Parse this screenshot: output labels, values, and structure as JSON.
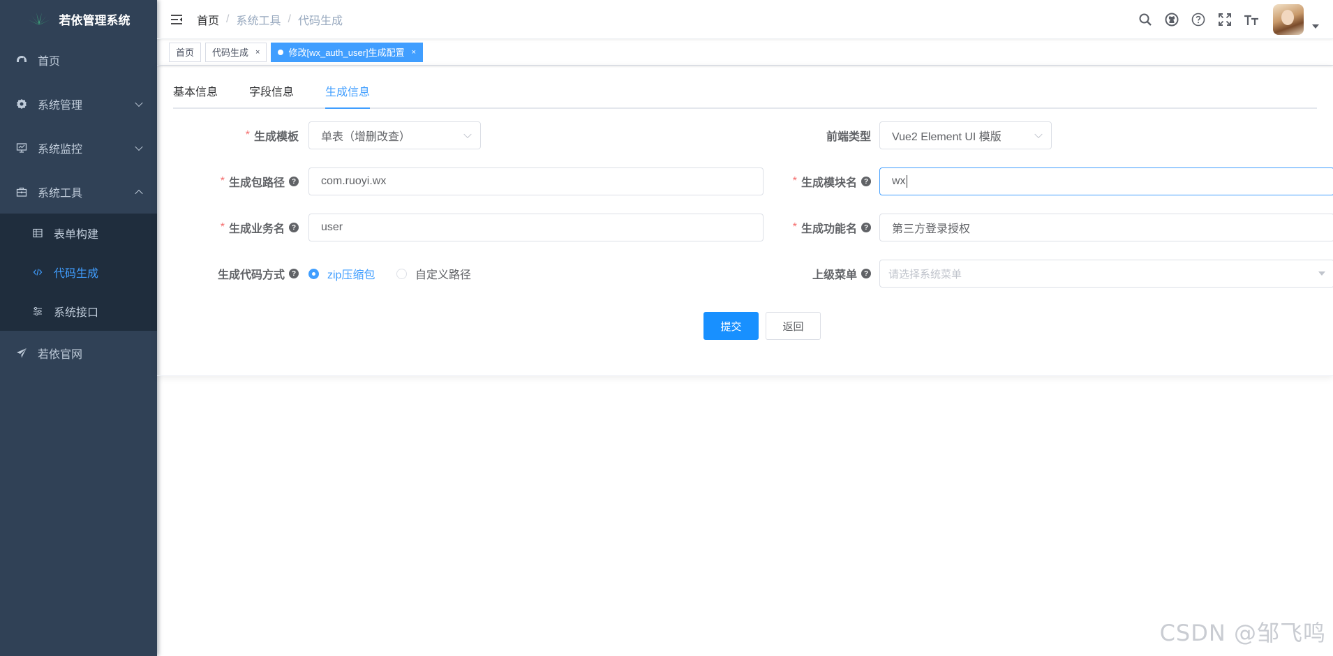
{
  "app": {
    "title": "若依管理系统"
  },
  "sidebar": {
    "items": [
      {
        "label": "首页",
        "icon": "dashboard-icon"
      },
      {
        "label": "系统管理",
        "icon": "gear-icon"
      },
      {
        "label": "系统监控",
        "icon": "monitor-icon"
      },
      {
        "label": "系统工具",
        "icon": "toolbox-icon",
        "expanded": true
      },
      {
        "label": "若依官网",
        "icon": "send-icon"
      }
    ],
    "submenu": [
      {
        "label": "表单构建",
        "icon": "table-icon"
      },
      {
        "label": "代码生成",
        "icon": "code-icon",
        "active": true
      },
      {
        "label": "系统接口",
        "icon": "sliders-icon"
      }
    ]
  },
  "navbar": {
    "breadcrumb": [
      "首页",
      "系统工具",
      "代码生成"
    ],
    "icons": [
      "search-icon",
      "github-icon",
      "question-icon",
      "fullscreen-icon",
      "font-size-icon"
    ]
  },
  "tags": [
    {
      "label": "首页"
    },
    {
      "label": "代码生成"
    },
    {
      "label": "修改[wx_auth_user]生成配置",
      "active": true
    }
  ],
  "tabs": [
    {
      "label": "基本信息"
    },
    {
      "label": "字段信息"
    },
    {
      "label": "生成信息",
      "active": true
    }
  ],
  "form": {
    "template": {
      "label": "生成模板",
      "value": "单表（增删改查）"
    },
    "frontend_type": {
      "label": "前端类型",
      "value": "Vue2 Element UI 模版"
    },
    "package_path": {
      "label": "生成包路径",
      "value": "com.ruoyi.wx"
    },
    "module_name": {
      "label": "生成模块名",
      "value": "wx"
    },
    "business_name": {
      "label": "生成业务名",
      "value": "user"
    },
    "function_name": {
      "label": "生成功能名",
      "value": "第三方登录授权"
    },
    "gen_type": {
      "label": "生成代码方式",
      "options": [
        "zip压缩包",
        "自定义路径"
      ],
      "selected": "zip压缩包"
    },
    "parent_menu": {
      "label": "上级菜单",
      "placeholder": "请选择系统菜单"
    },
    "submit_label": "提交",
    "back_label": "返回",
    "required_mark": "*",
    "help_mark": "?"
  },
  "watermark": "CSDN @邹飞鸣",
  "colors": {
    "sidebar_bg": "#304156",
    "accent": "#409eff",
    "primary_button": "#1890ff"
  }
}
